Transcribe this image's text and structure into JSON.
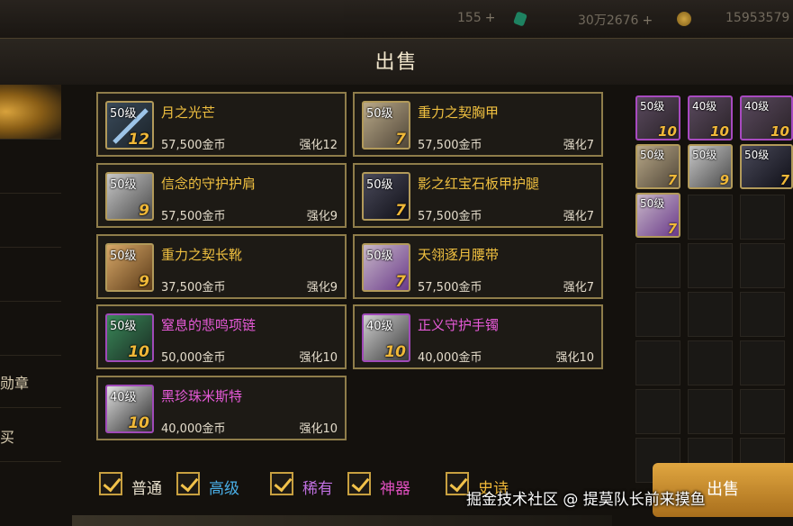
{
  "top_bar": {
    "res1": "155",
    "res2": "30万2676",
    "res3": "15953579",
    "plus": "+"
  },
  "panel": {
    "title": "出售"
  },
  "side_tabs": [
    {
      "label": ""
    },
    {
      "label": ""
    },
    {
      "label": ""
    },
    {
      "label": ""
    },
    {
      "label": ""
    },
    {
      "label": "勋章"
    },
    {
      "label": "买"
    }
  ],
  "items": [
    {
      "level": "50级",
      "enhance": "12",
      "name": "月之光芒",
      "price": "57,500金币",
      "strength": "强化12",
      "rarity": "rare"
    },
    {
      "level": "50级",
      "enhance": "7",
      "name": "重力之契胸甲",
      "price": "57,500金币",
      "strength": "强化7",
      "rarity": "rare"
    },
    {
      "level": "50级",
      "enhance": "9",
      "name": "信念的守护护肩",
      "price": "57,500金币",
      "strength": "强化9",
      "rarity": "rare"
    },
    {
      "level": "50级",
      "enhance": "7",
      "name": "影之红宝石板甲护腿",
      "price": "57,500金币",
      "strength": "强化7",
      "rarity": "rare"
    },
    {
      "level": "50级",
      "enhance": "9",
      "name": "重力之契长靴",
      "price": "37,500金币",
      "strength": "强化9",
      "rarity": "rare"
    },
    {
      "level": "50级",
      "enhance": "7",
      "name": "天翎逐月腰带",
      "price": "57,500金币",
      "strength": "强化7",
      "rarity": "rare"
    },
    {
      "level": "50级",
      "enhance": "10",
      "name": "窒息的悲鸣项链",
      "price": "50,000金币",
      "strength": "强化10",
      "rarity": "epic"
    },
    {
      "level": "40级",
      "enhance": "10",
      "name": "正义守护手镯",
      "price": "40,000金币",
      "strength": "强化10",
      "rarity": "epic"
    },
    {
      "level": "40级",
      "enhance": "10",
      "name": "黑珍珠米斯特",
      "price": "40,000金币",
      "strength": "强化10",
      "rarity": "epic"
    }
  ],
  "inventory": [
    {
      "level": "50级",
      "enhance": "10"
    },
    {
      "level": "40级",
      "enhance": "10"
    },
    {
      "level": "40级",
      "enhance": "10"
    },
    {
      "level": "50级",
      "enhance": "7"
    },
    {
      "level": "50级",
      "enhance": "9"
    },
    {
      "level": "50级",
      "enhance": "7"
    },
    {
      "level": "50级",
      "enhance": "7"
    }
  ],
  "filters": [
    {
      "label": "普通",
      "color": "#e8e0cc"
    },
    {
      "label": "高级",
      "color": "#4ab0e8"
    },
    {
      "label": "稀有",
      "color": "#c070e0"
    },
    {
      "label": "神器",
      "color": "#e050c0"
    },
    {
      "label": "史诗",
      "color": "#f0b838"
    }
  ],
  "sell_button": "出售",
  "watermark": "掘金技术社区 @ 提莫队长前来摸鱼"
}
